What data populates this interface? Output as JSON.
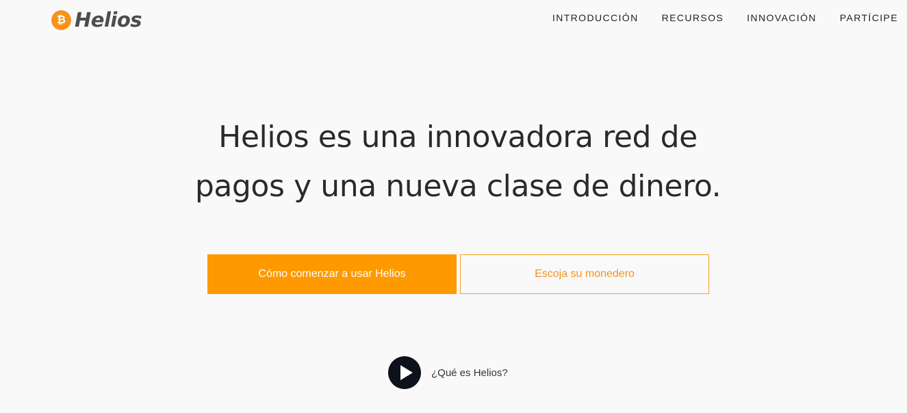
{
  "header": {
    "logo_text": "Helios",
    "logo_icon": "bitcoin-icon",
    "nav": [
      {
        "label": "INTRODUCCIÓN"
      },
      {
        "label": "RECURSOS"
      },
      {
        "label": "INNOVACIÓN"
      },
      {
        "label": "PARTÍCIPE"
      }
    ]
  },
  "hero": {
    "title_line1": "Helios es una innovadora red de",
    "title_line2": "pagos y una nueva clase de dinero.",
    "primary_button": "Cómo comenzar a usar Helios",
    "secondary_button": "Escoja su monedero",
    "video_label": "¿Qué es Helios?",
    "video_icon": "play-icon"
  },
  "colors": {
    "accent": "#ff9900",
    "logo": "#f7931a",
    "play_bg": "#0d111c",
    "background": "#f9f9f9"
  }
}
